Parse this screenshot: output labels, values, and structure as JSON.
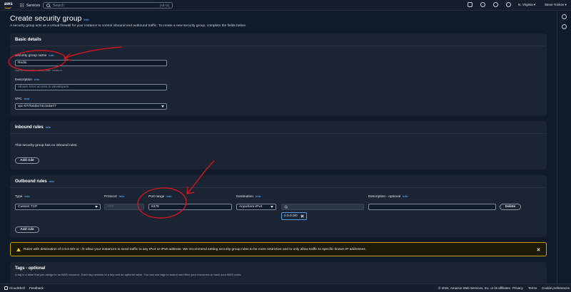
{
  "topbar": {
    "logo": "aws",
    "services_label": "Services",
    "search_placeholder": "Search",
    "search_shortcut": "[Alt+S]",
    "region": "N. Virginia ▾",
    "user": "Steve Yonkov ▾"
  },
  "page": {
    "title": "Create security group",
    "title_info": "Info",
    "description": "A security group acts as a virtual firewall for your instance to control inbound and outbound traffic. To create a new security group, complete the fields below."
  },
  "basic": {
    "heading": "Basic details",
    "name_label": "Security group name",
    "name_value": "Redis",
    "name_hint": "Name cannot be edited after creation.",
    "desc_label": "Description",
    "desc_placeholder": "Allows SSH access to developers",
    "vpc_label": "VPC",
    "vpc_value": "vpc-077b44bc74c118a77",
    "info": "Info"
  },
  "inbound": {
    "heading": "Inbound rules",
    "info": "Info",
    "empty_text": "This security group has no inbound rules.",
    "add_rule": "Add rule"
  },
  "outbound": {
    "heading": "Outbound rules",
    "info": "Info",
    "col_type": "Type",
    "col_protocol": "Protocol",
    "col_port": "Port range",
    "col_destination": "Destination",
    "col_description": "Description - optional",
    "type_value": "Custom TCP",
    "protocol_value": "TCP",
    "port_value": "6379",
    "destination_value": "Anywhere-IPv4",
    "cidr_token": "0.0.0.0/0",
    "delete": "Delete",
    "add_rule": "Add rule"
  },
  "alert": {
    "text": "Rules with destination of 0.0.0.0/0 or ::/0 allow your instances to send traffic to any IPv4 or IPv6 address. We recommend setting security group rules to be more restrictive and to only allow traffic to specific known IP addresses."
  },
  "tags": {
    "title_prefix": "Tags - ",
    "title_optional": "optional",
    "description": "A tag is a label that you assign to an AWS resource. Each tag consists of a key and an optional value. You can use tags to search and filter your resources or track your AWS costs."
  },
  "footer": {
    "cloudshell": "CloudShell",
    "feedback": "Feedback",
    "copyright": "© 2024, Amazon Web Services, Inc. or its affiliates.",
    "privacy": "Privacy",
    "terms": "Terms",
    "cookies": "Cookie preferences"
  },
  "colors": {
    "annotation": "#e8141c",
    "link": "#539fe5",
    "warning": "#c8a100"
  }
}
